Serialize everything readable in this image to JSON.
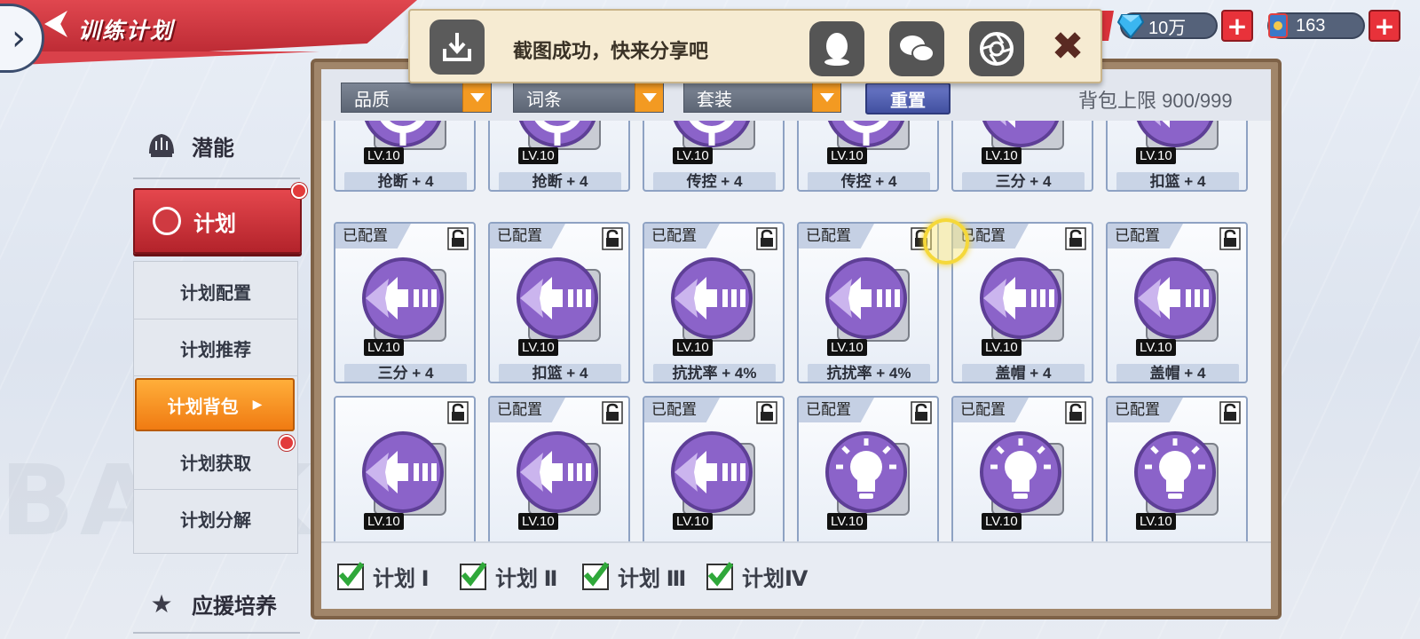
{
  "header": {
    "title": "训练计划",
    "currencies": [
      {
        "icon": "diamond-icon",
        "value": "10万"
      },
      {
        "icon": "card-icon",
        "value": "163"
      }
    ]
  },
  "share_popup": {
    "message": "截图成功，快来分享吧",
    "apps": [
      "qq-icon",
      "wechat-icon",
      "camera-shutter-icon"
    ],
    "close_glyph": "✖"
  },
  "sidebar": {
    "potential": "潜能",
    "plan": "计划",
    "sub_items": [
      "计划配置",
      "计划推荐",
      "计划背包",
      "计划获取",
      "计划分解"
    ],
    "active_index": 2,
    "support": "应援培养"
  },
  "filters": {
    "dropdowns": [
      "品质",
      "词条",
      "套装"
    ],
    "reset_label": "重置",
    "capacity": "背包上限 900/999"
  },
  "cards": [
    {
      "tag": "",
      "lv": "LV.10",
      "name": "抢断 + 4",
      "icon": "target"
    },
    {
      "tag": "",
      "lv": "LV.10",
      "name": "抢断 + 4",
      "icon": "target"
    },
    {
      "tag": "",
      "lv": "LV.10",
      "name": "传控 + 4",
      "icon": "target"
    },
    {
      "tag": "",
      "lv": "LV.10",
      "name": "传控 + 4",
      "icon": "target"
    },
    {
      "tag": "",
      "lv": "LV.10",
      "name": "三分 + 4",
      "icon": "arrow"
    },
    {
      "tag": "",
      "lv": "LV.10",
      "name": "扣篮 + 4",
      "icon": "arrow"
    },
    {
      "tag": "已配置",
      "lv": "LV.10",
      "name": "三分 + 4",
      "icon": "arrow"
    },
    {
      "tag": "已配置",
      "lv": "LV.10",
      "name": "扣篮 + 4",
      "icon": "arrow"
    },
    {
      "tag": "已配置",
      "lv": "LV.10",
      "name": "抗扰率 + 4%",
      "icon": "arrow"
    },
    {
      "tag": "已配置",
      "lv": "LV.10",
      "name": "抗扰率 + 4%",
      "icon": "arrow"
    },
    {
      "tag": "已配置",
      "lv": "LV.10",
      "name": "盖帽 + 4",
      "icon": "arrow"
    },
    {
      "tag": "已配置",
      "lv": "LV.10",
      "name": "盖帽 + 4",
      "icon": "arrow"
    },
    {
      "tag": "",
      "lv": "LV.10",
      "name": "",
      "icon": "arrow"
    },
    {
      "tag": "已配置",
      "lv": "LV.10",
      "name": "",
      "icon": "arrow"
    },
    {
      "tag": "已配置",
      "lv": "LV.10",
      "name": "",
      "icon": "arrow"
    },
    {
      "tag": "已配置",
      "lv": "LV.10",
      "name": "",
      "icon": "bulb"
    },
    {
      "tag": "已配置",
      "lv": "LV.10",
      "name": "",
      "icon": "bulb"
    },
    {
      "tag": "已配置",
      "lv": "LV.10",
      "name": "",
      "icon": "bulb"
    }
  ],
  "plan_filters": [
    "计划 Ⅰ",
    "计划 Ⅱ",
    "计划 Ⅲ",
    "计划Ⅳ"
  ],
  "watermark": "BASKET",
  "colors": {
    "accent_red": "#c8313a",
    "accent_orange": "#f07b12",
    "icon_purple": "#8b63c9",
    "reset_blue": "#4150a0"
  }
}
